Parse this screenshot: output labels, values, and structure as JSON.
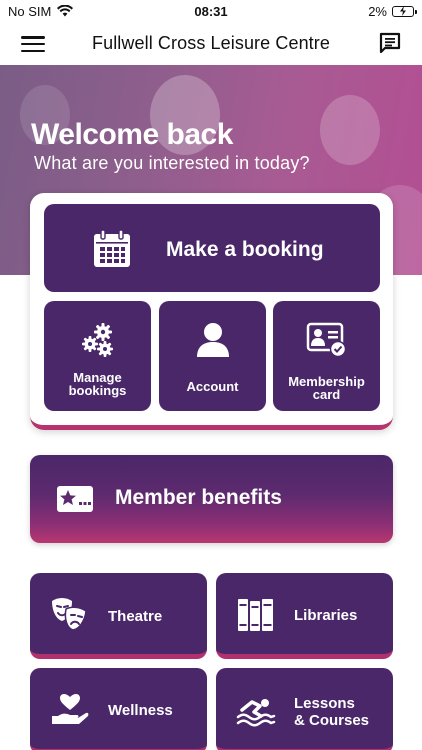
{
  "status_bar": {
    "carrier": "No SIM",
    "time": "08:31",
    "battery": "2%"
  },
  "header": {
    "title": "Fullwell Cross Leisure Centre",
    "menu_icon": "hamburger-menu-icon",
    "chat_icon": "chat-message-icon"
  },
  "hero": {
    "title": "Welcome back",
    "subtitle": "What are you interested in today?"
  },
  "actions": {
    "booking": {
      "label": "Make a booking",
      "icon": "calendar-icon"
    },
    "manage": {
      "label_line1": "Manage",
      "label_line2": "bookings",
      "icon": "gears-icon"
    },
    "account": {
      "label": "Account",
      "icon": "user-icon"
    },
    "membership": {
      "label_line1": "Membership",
      "label_line2": "card",
      "icon": "membership-card-icon"
    }
  },
  "benefits": {
    "label": "Member benefits",
    "icon": "star-card-icon"
  },
  "categories": {
    "theatre": {
      "label": "Theatre",
      "icon": "theatre-masks-icon"
    },
    "libraries": {
      "label": "Libraries",
      "icon": "books-icon"
    },
    "wellness": {
      "label": "Wellness",
      "icon": "heart-hand-icon"
    },
    "lessons": {
      "label_line1": "Lessons",
      "label_line2": "& Courses",
      "icon": "swimmer-icon"
    }
  },
  "colors": {
    "tile": "#4a2769",
    "accent": "#b7336f",
    "hero_start": "#7a5d86",
    "hero_end": "#b34e93"
  }
}
